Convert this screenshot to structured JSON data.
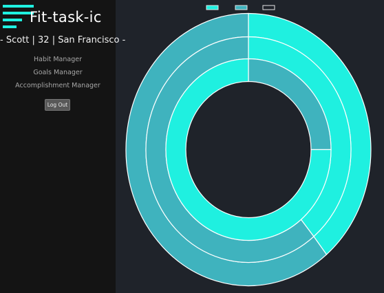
{
  "app": {
    "title": "Fit-task-ic",
    "profile": "- Scott | 32 | San Francisco -",
    "logo_icon": "hamburger-menu-icon"
  },
  "nav": {
    "items": [
      {
        "label": "Habit Manager"
      },
      {
        "label": "Goals Manager"
      },
      {
        "label": "Accomplishment Manager"
      }
    ],
    "logout_label": "Log Out"
  },
  "colors": {
    "accent": "#1ff0e0",
    "teal": "#3fb3be",
    "page_bg": "#1f232a",
    "sidebar_bg": "#141414"
  },
  "chart_data": {
    "type": "doughnut",
    "legend_position": "top",
    "legend": [
      {
        "color": "#1ff0e0"
      },
      {
        "color": "#3fb3be"
      },
      {
        "color": "#1f232a"
      }
    ],
    "series": [
      {
        "values": [
          39,
          61
        ],
        "colors": [
          "#1ff0e0",
          "#3fb3be"
        ]
      },
      {
        "values": [
          39,
          61
        ],
        "colors": [
          "#1ff0e0",
          "#3fb3be"
        ]
      },
      {
        "values": [
          25,
          75
        ],
        "colors": [
          "#3fb3be",
          "#1ff0e0"
        ]
      }
    ]
  }
}
